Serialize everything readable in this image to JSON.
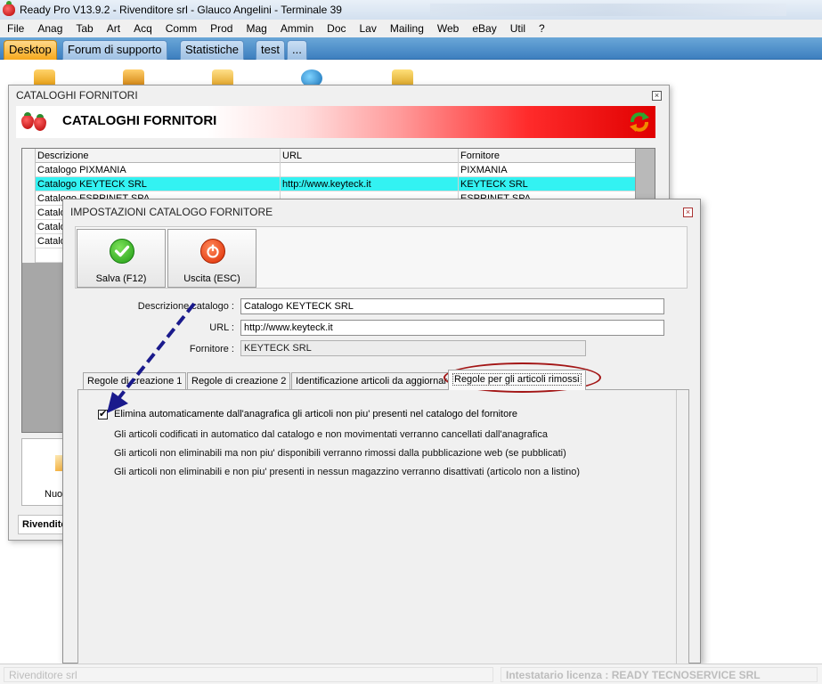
{
  "window": {
    "title": "Ready Pro V13.9.2 - Rivenditore srl - Glauco Angelini - Terminale 39"
  },
  "menu": {
    "items": [
      "File",
      "Anag",
      "Tab",
      "Art",
      "Acq",
      "Comm",
      "Prod",
      "Mag",
      "Ammin",
      "Doc",
      "Lav",
      "Mailing",
      "Web",
      "eBay",
      "Util",
      "?"
    ]
  },
  "top_tabs": {
    "items": [
      "Desktop",
      "Forum di supporto",
      "Statistiche",
      "test",
      "..."
    ],
    "active": "Desktop"
  },
  "cataloghi_window": {
    "title": "CATALOGHI FORNITORI",
    "banner_title": "CATALOGHI FORNITORI",
    "columns": [
      "Descrizione",
      "URL",
      "Fornitore"
    ],
    "rows": [
      {
        "descrizione": "Catalogo PIXMANIA",
        "url": "",
        "fornitore": "PIXMANIA"
      },
      {
        "descrizione": "Catalogo KEYTECK SRL",
        "url": "http://www.keyteck.it",
        "fornitore": "KEYTECK SRL"
      },
      {
        "descrizione": "Catalogo ESPRINET SPA",
        "url": "",
        "fornitore": "ESPRINET SPA"
      },
      {
        "descrizione": "Catalo",
        "url": "",
        "fornitore": ""
      },
      {
        "descrizione": "Catalo",
        "url": "",
        "fornitore": ""
      },
      {
        "descrizione": "Catalo",
        "url": "",
        "fornitore": ""
      }
    ],
    "selected_row": 1,
    "new_button_label": "Nuo",
    "bottom_tab_label": "Rivendito"
  },
  "dialog": {
    "title": "IMPOSTAZIONI CATALOGO FORNITORE",
    "save_label": "Salva (F12)",
    "exit_label": "Uscita (ESC)",
    "fields": {
      "descrizione_label": "Descrizione catalogo :",
      "descrizione_value": "Catalogo KEYTECK SRL",
      "url_label": "URL :",
      "url_value": "http://www.keyteck.it",
      "fornitore_label": "Fornitore :",
      "fornitore_value": "KEYTECK SRL"
    },
    "tabs": [
      "Regole di creazione 1",
      "Regole di creazione 2",
      "Identificazione articoli da aggiornare",
      "Regole per gli articoli rimossi"
    ],
    "active_tab": "Regole per gli articoli rimossi",
    "checkbox_label": "Elimina automaticamente dall'anagrafica gli articoli non piu' presenti nel catalogo del fornitore",
    "checkbox_checked": true,
    "info_lines": [
      "Gli articoli codificati in automatico dal catalogo e non movimentati verranno cancellati dall'anagrafica",
      "Gli articoli non eliminabili ma non piu' disponibili verranno rimossi dalla pubblicazione web (se pubblicati)",
      "Gli articoli non eliminabili e non piu' presenti in nessun magazzino verranno disattivati (articolo non a listino)"
    ]
  },
  "status": {
    "left": "Rivenditore srl",
    "right": "Intestatario licenza : READY TECNOSERVICE SRL"
  },
  "colors": {
    "selected_row": "#33f2f2",
    "active_tab": "#f6a81c",
    "tab_bar": "#3d7fbf",
    "banner_red": "#e00000",
    "highlight_oval": "#a31616",
    "arrow": "#1a1a8c"
  },
  "icons": {
    "save": "green-check-icon",
    "exit": "power-off-icon",
    "refresh": "refresh-arrows-icon",
    "app": "strawberry-icon"
  }
}
